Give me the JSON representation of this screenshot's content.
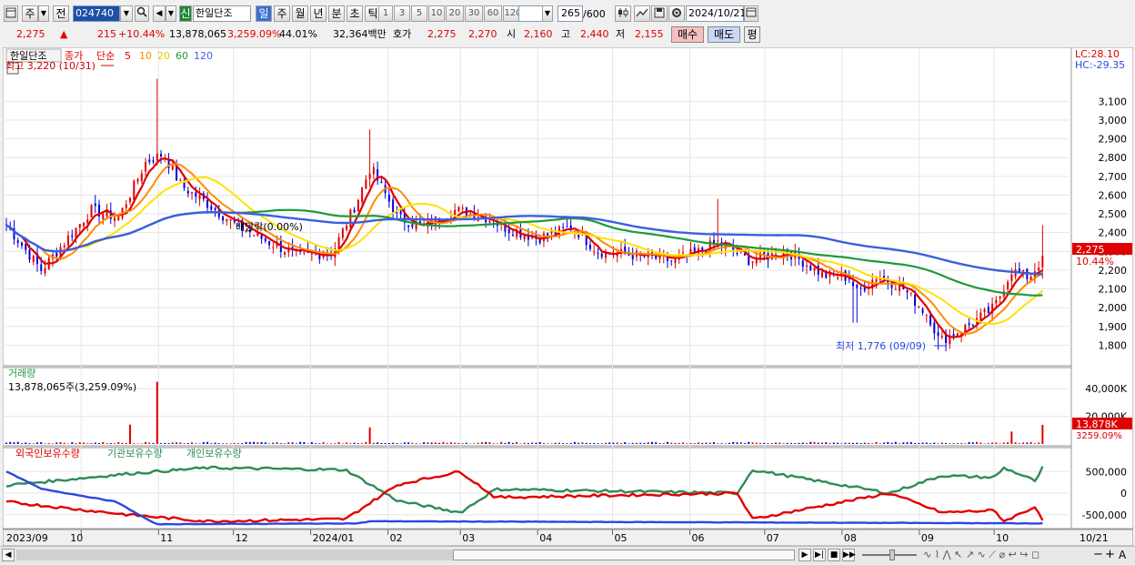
{
  "toolbar": {
    "market": "주",
    "prev": "전",
    "code": "024740",
    "badge": "신",
    "name": "한일단조",
    "periods": [
      "일",
      "주",
      "월",
      "년",
      "분",
      "초",
      "틱"
    ],
    "active_period": "일",
    "numbers": [
      "1",
      "3",
      "5",
      "10",
      "20",
      "30",
      "60",
      "120"
    ],
    "count": "265",
    "count_total": "/600",
    "date": "2024/10/21"
  },
  "quote": {
    "price": "2,275",
    "arrow": "▲",
    "change": "215",
    "pct": "+10.44%",
    "volume": "13,878,065",
    "vol_ratio": "3,259.09%",
    "turnover": "44.01%",
    "amount": "32,364백만",
    "bid_label": "호가",
    "bid": "2,275",
    "ask": "2,270",
    "open_label": "시",
    "open": "2,160",
    "high_label": "고",
    "high": "2,440",
    "low_label": "저",
    "low": "2,155",
    "buy_btn": "매수",
    "sell_btn": "매도",
    "eval_btn": "평"
  },
  "colors": {
    "up": "#e00000",
    "down": "#0000e0",
    "ma5": "#e00000",
    "ma10": "#ff8c00",
    "ma20": "#ffe100",
    "ma60": "#1e9a3c",
    "ma120": "#3b5fe0",
    "foreign": "#e00000",
    "institution": "#2e8b57",
    "individual": "#2a48e0"
  },
  "chart_data": [
    {
      "type": "candlestick",
      "title": "",
      "legend": [
        "한일단조",
        "종가",
        "단순",
        "5",
        "10",
        "20",
        "60",
        "120"
      ],
      "legend_placement": "top-left",
      "x_ticks": [
        "2023/09",
        "10",
        "11",
        "12",
        "2024/01",
        "02",
        "03",
        "04",
        "05",
        "06",
        "07",
        "08",
        "09",
        "10",
        "10/21"
      ],
      "y_ticks": [
        "3,100",
        "3,000",
        "2,900",
        "2,800",
        "2,700",
        "2,600",
        "2,500",
        "2,400",
        "2,300",
        "2,200",
        "2,100",
        "2,000",
        "1,900",
        "1,800"
      ],
      "ylim": [
        1700,
        3320
      ],
      "grid": true,
      "lc": "LC:28.10",
      "hc": "HC:-29.35",
      "current_price_label": "2,275",
      "current_pct_label": "10.44%",
      "annotations": {
        "high": "최고 3,220 (10/31)",
        "low": "최저 1,776 (09/09)",
        "dividend": "배당락(0.00%)"
      },
      "high_value": 3220,
      "low_value": 1776,
      "close_series": [
        {
          "date": "2023-09-01",
          "close": 2440
        },
        {
          "date": "2023-09-15",
          "close": 2200
        },
        {
          "date": "2023-09-25",
          "close": 2360
        },
        {
          "date": "2023-10-05",
          "close": 2520
        },
        {
          "date": "2023-10-16",
          "close": 2480
        },
        {
          "date": "2023-10-27",
          "close": 2780
        },
        {
          "date": "2023-11-03",
          "close": 2820
        },
        {
          "date": "2023-11-10",
          "close": 2650
        },
        {
          "date": "2023-11-20",
          "close": 2560
        },
        {
          "date": "2023-12-01",
          "close": 2450
        },
        {
          "date": "2023-12-15",
          "close": 2350
        },
        {
          "date": "2023-12-28",
          "close": 2270
        },
        {
          "date": "2024-01-10",
          "close": 2300
        },
        {
          "date": "2024-01-20",
          "close": 2580
        },
        {
          "date": "2024-01-25",
          "close": 2750
        },
        {
          "date": "2024-02-05",
          "close": 2480
        },
        {
          "date": "2024-02-15",
          "close": 2430
        },
        {
          "date": "2024-02-28",
          "close": 2520
        },
        {
          "date": "2024-03-10",
          "close": 2490
        },
        {
          "date": "2024-03-20",
          "close": 2420
        },
        {
          "date": "2024-04-01",
          "close": 2370
        },
        {
          "date": "2024-04-15",
          "close": 2430
        },
        {
          "date": "2024-04-25",
          "close": 2300
        },
        {
          "date": "2024-05-10",
          "close": 2280
        },
        {
          "date": "2024-05-25",
          "close": 2250
        },
        {
          "date": "2024-06-05",
          "close": 2300
        },
        {
          "date": "2024-06-12",
          "close": 2350
        },
        {
          "date": "2024-06-25",
          "close": 2250
        },
        {
          "date": "2024-07-10",
          "close": 2300
        },
        {
          "date": "2024-07-25",
          "close": 2170
        },
        {
          "date": "2024-08-05",
          "close": 2160
        },
        {
          "date": "2024-08-06",
          "close": 2070
        },
        {
          "date": "2024-08-15",
          "close": 2170
        },
        {
          "date": "2024-08-25",
          "close": 2110
        },
        {
          "date": "2024-09-05",
          "close": 1950
        },
        {
          "date": "2024-09-09",
          "close": 1820
        },
        {
          "date": "2024-09-20",
          "close": 1900
        },
        {
          "date": "2024-10-01",
          "close": 2000
        },
        {
          "date": "2024-10-08",
          "close": 2200
        },
        {
          "date": "2024-10-15",
          "close": 2160
        },
        {
          "date": "2024-10-21",
          "close": 2275
        }
      ]
    },
    {
      "type": "bar",
      "title": "거래량",
      "label": "13,878,065주(3,259.09%)",
      "y_ticks": [
        "40,000K",
        "20,000K"
      ],
      "ylim": [
        0,
        50000
      ],
      "current_label": "13,878K",
      "current_pct": "3259.09%",
      "spikes": [
        {
          "date": "2023-10-20",
          "value": 14000
        },
        {
          "date": "2023-10-31",
          "value": 45000
        },
        {
          "date": "2024-01-25",
          "value": 12000
        },
        {
          "date": "2024-10-08",
          "value": 9000
        },
        {
          "date": "2024-10-21",
          "value": 13878
        }
      ]
    },
    {
      "type": "line",
      "legend": [
        "외국인보유수량",
        "기관보유수량",
        "개인보유수량"
      ],
      "y_ticks": [
        "500,000",
        "0",
        "-500,000"
      ],
      "ylim": [
        -800000,
        800000
      ]
    }
  ],
  "scrollbar": {
    "buttons": [
      "◀",
      "▶",
      "▶|",
      "■",
      "▶▶"
    ],
    "zoom_minus": "−",
    "zoom_plus": "+",
    "auto_label": "A"
  }
}
